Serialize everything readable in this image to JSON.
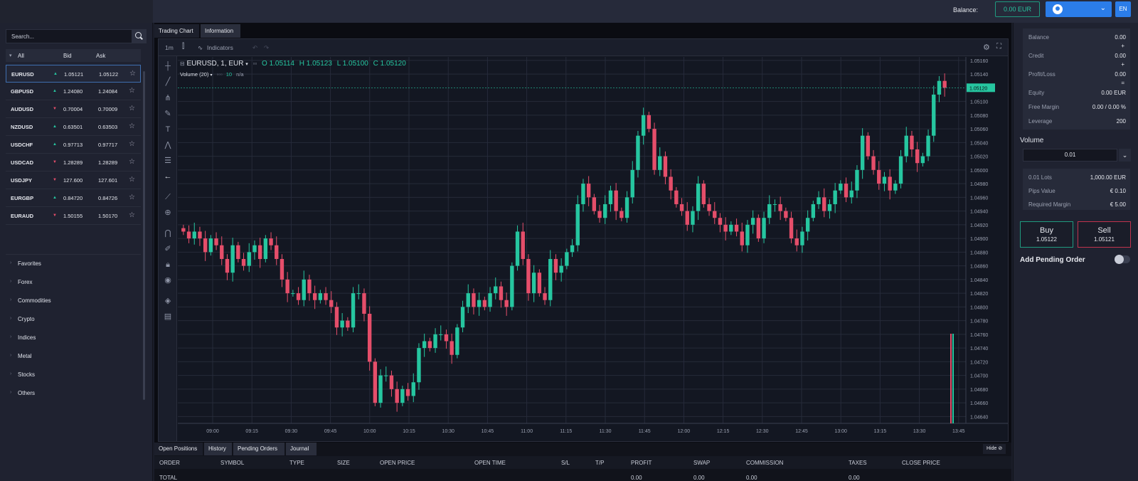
{
  "header": {
    "balance_label": "Balance:",
    "balance_value": "0.00 EUR",
    "user_icon": "user-avatar-icon",
    "language": "EN"
  },
  "watchlist": {
    "search_placeholder": "Search...",
    "columns": {
      "all": "All",
      "bid": "Bid",
      "ask": "Ask"
    },
    "rows": [
      {
        "symbol": "EURUSD",
        "dir": "up",
        "bid": "1.05121",
        "ask": "1.05122",
        "selected": true
      },
      {
        "symbol": "GBPUSD",
        "dir": "up",
        "bid": "1.24080",
        "ask": "1.24084"
      },
      {
        "symbol": "AUDUSD",
        "dir": "down",
        "bid": "0.70004",
        "ask": "0.70009"
      },
      {
        "symbol": "NZDUSD",
        "dir": "up",
        "bid": "0.63501",
        "ask": "0.63503"
      },
      {
        "symbol": "USDCHF",
        "dir": "up",
        "bid": "0.97713",
        "ask": "0.97717"
      },
      {
        "symbol": "USDCAD",
        "dir": "down",
        "bid": "1.28289",
        "ask": "1.28289"
      },
      {
        "symbol": "USDJPY",
        "dir": "down",
        "bid": "127.600",
        "ask": "127.601"
      },
      {
        "symbol": "EURGBP",
        "dir": "up",
        "bid": "0.84720",
        "ask": "0.84726"
      },
      {
        "symbol": "EURAUD",
        "dir": "down",
        "bid": "1.50155",
        "ask": "1.50170"
      }
    ],
    "categories": [
      "Favorites",
      "Forex",
      "Commodities",
      "Crypto",
      "Indices",
      "Metal",
      "Stocks",
      "Others"
    ]
  },
  "chart_tabs": [
    "Trading Chart",
    "Information"
  ],
  "chart_toolbar": {
    "interval": "1m",
    "indicators_label": "Indicators"
  },
  "chart_legend": {
    "symbol": "EURUSD, 1, EUR",
    "open": "O 1.05114",
    "high": "H 1.05123",
    "low": "L 1.05100",
    "close": "C 1.05120",
    "volume_label": "Volume (20)",
    "volume_value": "10",
    "volume_na": "n/a"
  },
  "colors": {
    "up": "#26c6a0",
    "down": "#e54e6a",
    "accent": "#2b7de9"
  },
  "chart_data": {
    "type": "candlestick",
    "title": "EURUSD, 1, EUR",
    "x_ticks": [
      "09:00",
      "09:15",
      "09:30",
      "09:45",
      "10:00",
      "10:15",
      "10:30",
      "10:45",
      "11:00",
      "11:15",
      "11:30",
      "11:45",
      "12:00",
      "12:15",
      "12:30",
      "12:45",
      "13:00",
      "13:15",
      "13:30",
      "13:45"
    ],
    "y_ticks": [
      "1.05160",
      "1.05140",
      "1.05100",
      "1.05080",
      "1.05060",
      "1.05040",
      "1.05020",
      "1.05000",
      "1.04980",
      "1.04960",
      "1.04940",
      "1.04920",
      "1.04900",
      "1.04880",
      "1.04860",
      "1.04840",
      "1.04820",
      "1.04800",
      "1.04780",
      "1.04760",
      "1.04740",
      "1.04720",
      "1.04700",
      "1.04680",
      "1.04660",
      "1.04640"
    ],
    "ylim": [
      1.0463,
      1.05165
    ],
    "last_price": "1.05120",
    "closes": [
      1.0491,
      1.049,
      1.0491,
      1.049,
      1.0488,
      1.049,
      1.0489,
      1.0487,
      1.0485,
      1.0489,
      1.0487,
      1.0486,
      1.0488,
      1.0489,
      1.0487,
      1.049,
      1.0489,
      1.0487,
      1.0484,
      1.0482,
      1.0482,
      1.0481,
      1.0484,
      1.0482,
      1.0481,
      1.0482,
      1.0481,
      1.048,
      1.0477,
      1.0478,
      1.0477,
      1.0482,
      1.0482,
      1.0479,
      1.0472,
      1.0466,
      1.047,
      1.047,
      1.0468,
      1.0466,
      1.0468,
      1.0467,
      1.0469,
      1.0474,
      1.0475,
      1.0474,
      1.0476,
      1.0476,
      1.0475,
      1.0473,
      1.0477,
      1.048,
      1.0482,
      1.048,
      1.0481,
      1.048,
      1.0482,
      1.0483,
      1.0481,
      1.048,
      1.0486,
      1.0491,
      1.0487,
      1.0482,
      1.0485,
      1.0482,
      1.0481,
      1.0487,
      1.0485,
      1.0486,
      1.0488,
      1.0489,
      1.0495,
      1.0498,
      1.0496,
      1.0494,
      1.0493,
      1.0495,
      1.0497,
      1.0494,
      1.0493,
      1.0496,
      1.05,
      1.0505,
      1.0508,
      1.0506,
      1.05,
      1.0502,
      1.0499,
      1.0497,
      1.0495,
      1.0494,
      1.0492,
      1.0494,
      1.0498,
      1.0495,
      1.0494,
      1.0493,
      1.0492,
      1.0491,
      1.0492,
      1.0491,
      1.0489,
      1.0492,
      1.0493,
      1.049,
      1.0493,
      1.0495,
      1.0495,
      1.0494,
      1.0493,
      1.049,
      1.0489,
      1.0491,
      1.0493,
      1.0495,
      1.0496,
      1.0494,
      1.0495,
      1.0497,
      1.0498,
      1.0496,
      1.0497,
      1.05,
      1.0505,
      1.0502,
      1.05,
      1.0498,
      1.0499,
      1.0497,
      1.0498,
      1.0502,
      1.0505,
      1.0503,
      1.0501,
      1.0502,
      1.0505,
      1.0511,
      1.0513,
      1.0512
    ]
  },
  "bottom_panel": {
    "tabs": [
      "Open Positions",
      "History",
      "Pending Orders",
      "Journal"
    ],
    "hide_label": "Hide",
    "columns": [
      "ORDER",
      "SYMBOL",
      "TYPE",
      "SIZE",
      "OPEN PRICE",
      "OPEN TIME",
      "S/L",
      "T/P",
      "PROFIT",
      "SWAP",
      "COMMISSION",
      "TAXES",
      "CLOSE PRICE"
    ],
    "total_row": {
      "label": "TOTAL",
      "profit": "0.00",
      "swap": "0.00",
      "commission": "0.00",
      "taxes": "0.00"
    }
  },
  "account": {
    "rows": [
      {
        "label": "Balance",
        "value": "0.00",
        "sep": "+"
      },
      {
        "label": "Credit",
        "value": "0.00",
        "sep": "+"
      },
      {
        "label": "Profit/Loss",
        "value": "0.00",
        "sep": "="
      },
      {
        "label": "Equity",
        "value": "0.00 EUR"
      },
      {
        "label": "Free Margin",
        "value": "0.00 / 0.00 %"
      },
      {
        "label": "Leverage",
        "value": "200"
      }
    ],
    "volume_label": "Volume",
    "volume_value": "0.01",
    "info_rows": [
      {
        "label": "0.01 Lots",
        "value": "1,000.00 EUR"
      },
      {
        "label": "Pips Value",
        "value": "€ 0.10"
      },
      {
        "label": "Required Margin",
        "value": "€ 5.00"
      }
    ],
    "buy_label": "Buy",
    "buy_price": "1.05122",
    "sell_label": "Sell",
    "sell_price": "1.05121",
    "pending_label": "Add Pending Order"
  }
}
